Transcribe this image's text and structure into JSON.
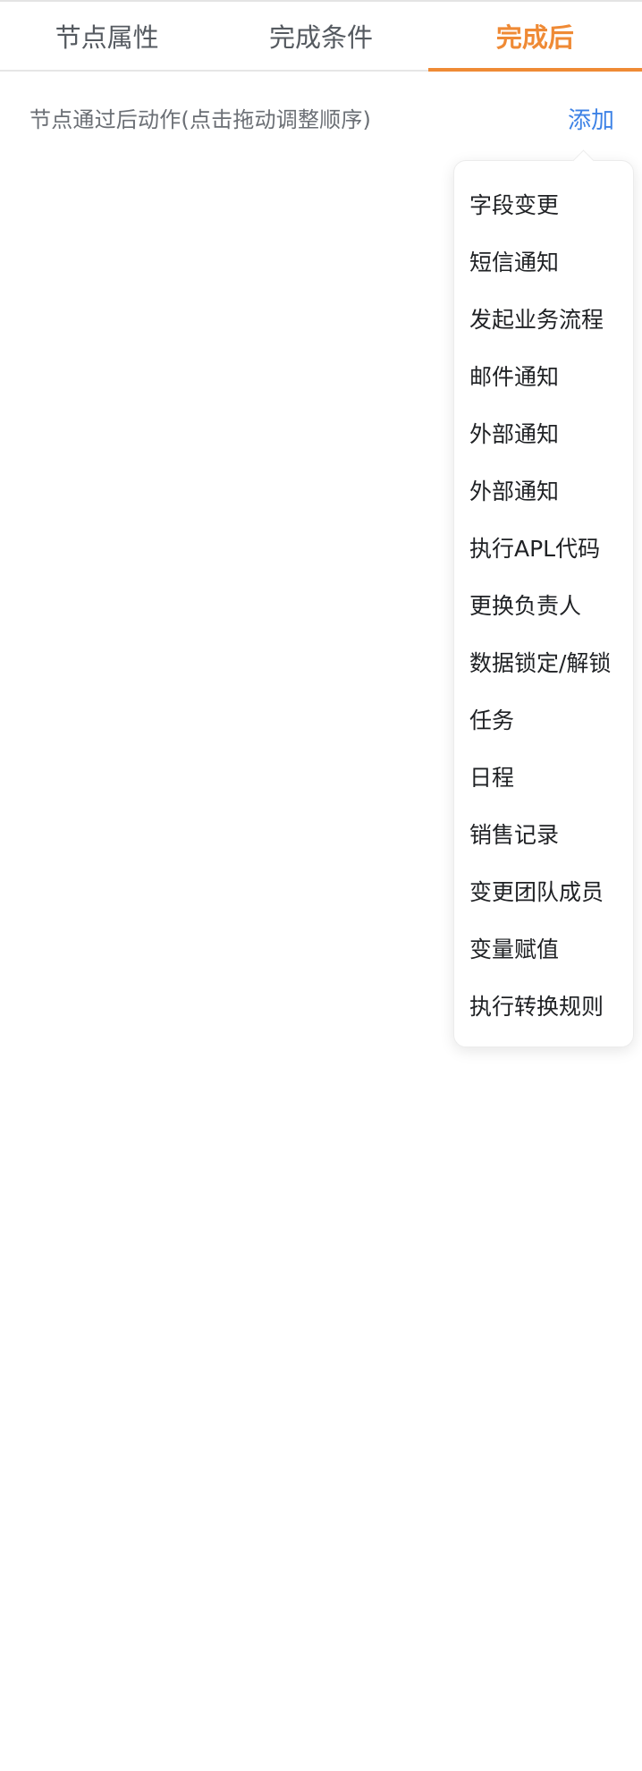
{
  "tabs": [
    {
      "label": "节点属性",
      "active": false
    },
    {
      "label": "完成条件",
      "active": false
    },
    {
      "label": "完成后",
      "active": true
    }
  ],
  "section": {
    "label": "节点通过后动作(点击拖动调整顺序)",
    "add_label": "添加"
  },
  "dropdown": {
    "items": [
      "字段变更",
      "短信通知",
      "发起业务流程",
      "邮件通知",
      "外部通知",
      "外部通知",
      "执行APL代码",
      "更换负责人",
      "数据锁定/解锁",
      "任务",
      "日程",
      "销售记录",
      "变更团队成员",
      "变量赋值",
      "执行转换规则"
    ]
  },
  "colors": {
    "accent": "#ef8a35",
    "link": "#3d82e6",
    "text_primary": "#1f2124",
    "text_secondary": "#6b6f75"
  }
}
